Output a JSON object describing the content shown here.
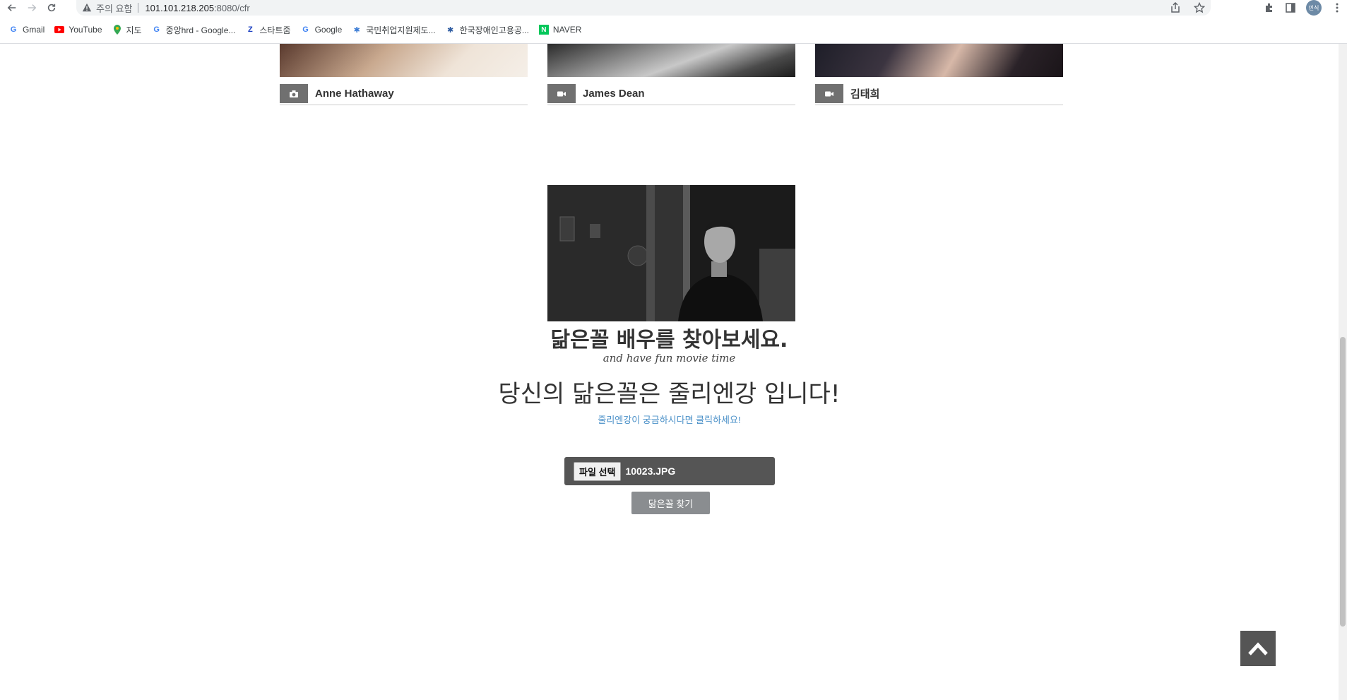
{
  "browser": {
    "warning": "주의 요함",
    "url_host": "101.101.218.205",
    "url_path": ":8080/cfr",
    "profile": "민식"
  },
  "bookmarks": [
    {
      "label": "Gmail",
      "icon": "google-g-icon"
    },
    {
      "label": "YouTube",
      "icon": "youtube-icon"
    },
    {
      "label": "지도",
      "icon": "maps-pin-icon"
    },
    {
      "label": "중앙hrd - Google...",
      "icon": "google-g-icon"
    },
    {
      "label": "스타트줌",
      "icon": "zoom-z-icon"
    },
    {
      "label": "Google",
      "icon": "google-g-icon"
    },
    {
      "label": "국민취업지원제도...",
      "icon": "gov-icon"
    },
    {
      "label": "한국장애인고용공...",
      "icon": "gov-icon"
    },
    {
      "label": "NAVER",
      "icon": "naver-icon"
    }
  ],
  "cards": [
    {
      "name": "Anne Hathaway",
      "icon": "camera-icon"
    },
    {
      "name": "James Dean",
      "icon": "video-camera-icon"
    },
    {
      "name": "김태희",
      "icon": "video-camera-icon"
    }
  ],
  "main": {
    "title": "닮은꼴 배우를 찾아보세요.",
    "subtitle": "and have fun movie time",
    "result": "당신의 닮은꼴은 줄리엔강 입니다!",
    "result_link": "줄리엔강이 궁금하시다면 클릭하세요!"
  },
  "upload": {
    "file_button": "파일 선택",
    "file_name": "10023.JPG",
    "submit": "닮은꼴 찾기"
  },
  "colors": {
    "link": "#4a90c8",
    "dark_button": "#555555",
    "submit_button": "#8a8d90"
  }
}
